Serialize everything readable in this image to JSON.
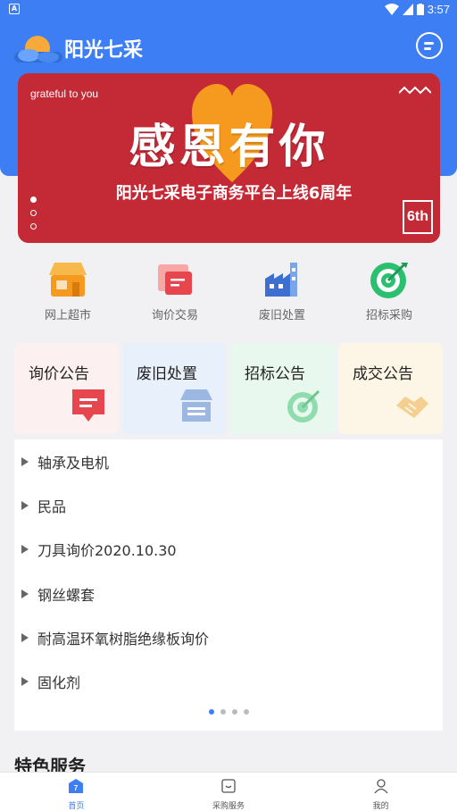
{
  "status_bar": {
    "time": "3:57"
  },
  "header": {
    "app_title": "阳光七采"
  },
  "banner": {
    "en_text": "grateful to you",
    "main_text": "感恩有你",
    "sub_text": "阳光七采电子商务平台上线6周年",
    "badge_text": "6th"
  },
  "quick_links": [
    {
      "label": "网上超市",
      "icon": "shop-icon"
    },
    {
      "label": "询价交易",
      "icon": "inquiry-icon"
    },
    {
      "label": "废旧处置",
      "icon": "factory-icon"
    },
    {
      "label": "招标采购",
      "icon": "target-icon"
    }
  ],
  "notice_cards": [
    {
      "label": "询价公告",
      "icon": "message-icon",
      "bg": "#fdf0f0"
    },
    {
      "label": "废旧处置",
      "icon": "store-icon",
      "bg": "#e8f0fb"
    },
    {
      "label": "招标公告",
      "icon": "target-icon",
      "bg": "#e9f8ee"
    },
    {
      "label": "成交公告",
      "icon": "handshake-icon",
      "bg": "#fdf5e6"
    }
  ],
  "notice_list": [
    "轴承及电机",
    "民品",
    "刀具询价2020.10.30",
    "钢丝螺套",
    "耐高温环氧树脂绝缘板询价",
    "固化剂"
  ],
  "pager": {
    "count": 4,
    "active": 0
  },
  "section": {
    "title": "特色服务"
  },
  "tabbar": {
    "tabs": [
      {
        "label": "首页",
        "icon": "home-icon",
        "active": true
      },
      {
        "label": "采购服务",
        "icon": "purchase-icon",
        "active": false
      },
      {
        "label": "我的",
        "icon": "profile-icon",
        "active": false
      }
    ]
  },
  "colors": {
    "primary": "#3d7ef5",
    "banner": "#c42a36"
  }
}
